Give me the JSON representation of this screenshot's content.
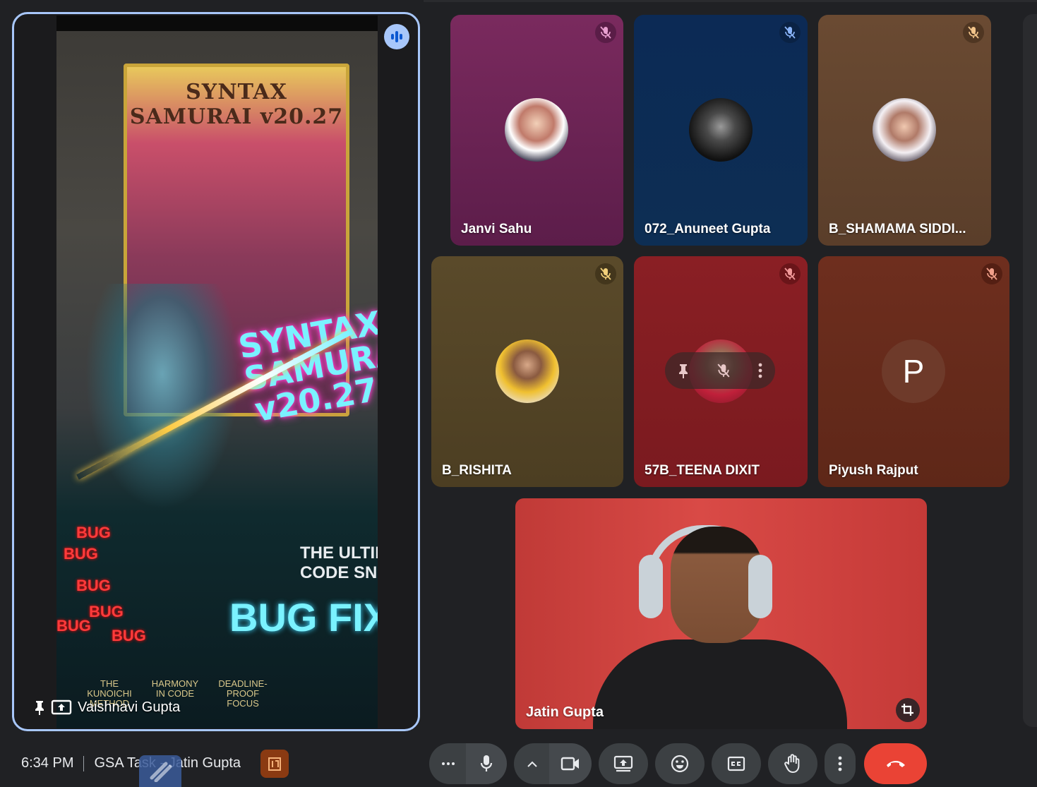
{
  "presenter": {
    "name": "Vaishnavi Gupta",
    "screen": {
      "poster_title": "SYNTAX SAMURAI v20.27",
      "neon_title_line1": "SYNTAX",
      "neon_title_line2": "SAMURAI",
      "neon_title_line3": "v20.27",
      "bug_words": [
        "BUG",
        "BUG",
        "BUG",
        "BUG",
        "BUG",
        "BUG"
      ],
      "tagline_line1": "THE ULTIM",
      "tagline_line2": "CODE SNI",
      "headline": "BUG FIXE",
      "features": [
        {
          "line1": "THE KUNOICHI",
          "line2": "METHOD"
        },
        {
          "line1": "HARMONY",
          "line2": "IN CODE"
        },
        {
          "line1": "DEADLINE-PROOF",
          "line2": "FOCUS"
        }
      ]
    }
  },
  "participants": [
    {
      "name": "Janvi Sahu",
      "bg": "#7a2a5e",
      "mute_bg": "#5a1d47"
    },
    {
      "name": "072_Anuneet Gupta",
      "bg": "#0d2b52",
      "mute_bg": "#0a2244"
    },
    {
      "name": "B_SHAMAMA SIDDI...",
      "bg": "#6a4a32",
      "mute_bg": "#4f3622"
    },
    {
      "name": "B_RISHITA",
      "bg": "#5a4a2a",
      "mute_bg": "#43361c"
    },
    {
      "name": "57B_TEENA DIXIT",
      "bg": "#8a1f24",
      "mute_bg": "#6a1519"
    },
    {
      "name": "Piyush Rajput",
      "bg": "#6e2e1e",
      "mute_bg": "#541f13",
      "initial": "P"
    }
  ],
  "self": {
    "name": "Jatin Gupta"
  },
  "bottom_bar": {
    "time": "6:34 PM",
    "meeting_title": "GSA Task - Jatin Gupta"
  },
  "colors": {
    "accent": "#a8c7fa",
    "control_bg": "#3c4043",
    "leave": "#ea4335"
  }
}
